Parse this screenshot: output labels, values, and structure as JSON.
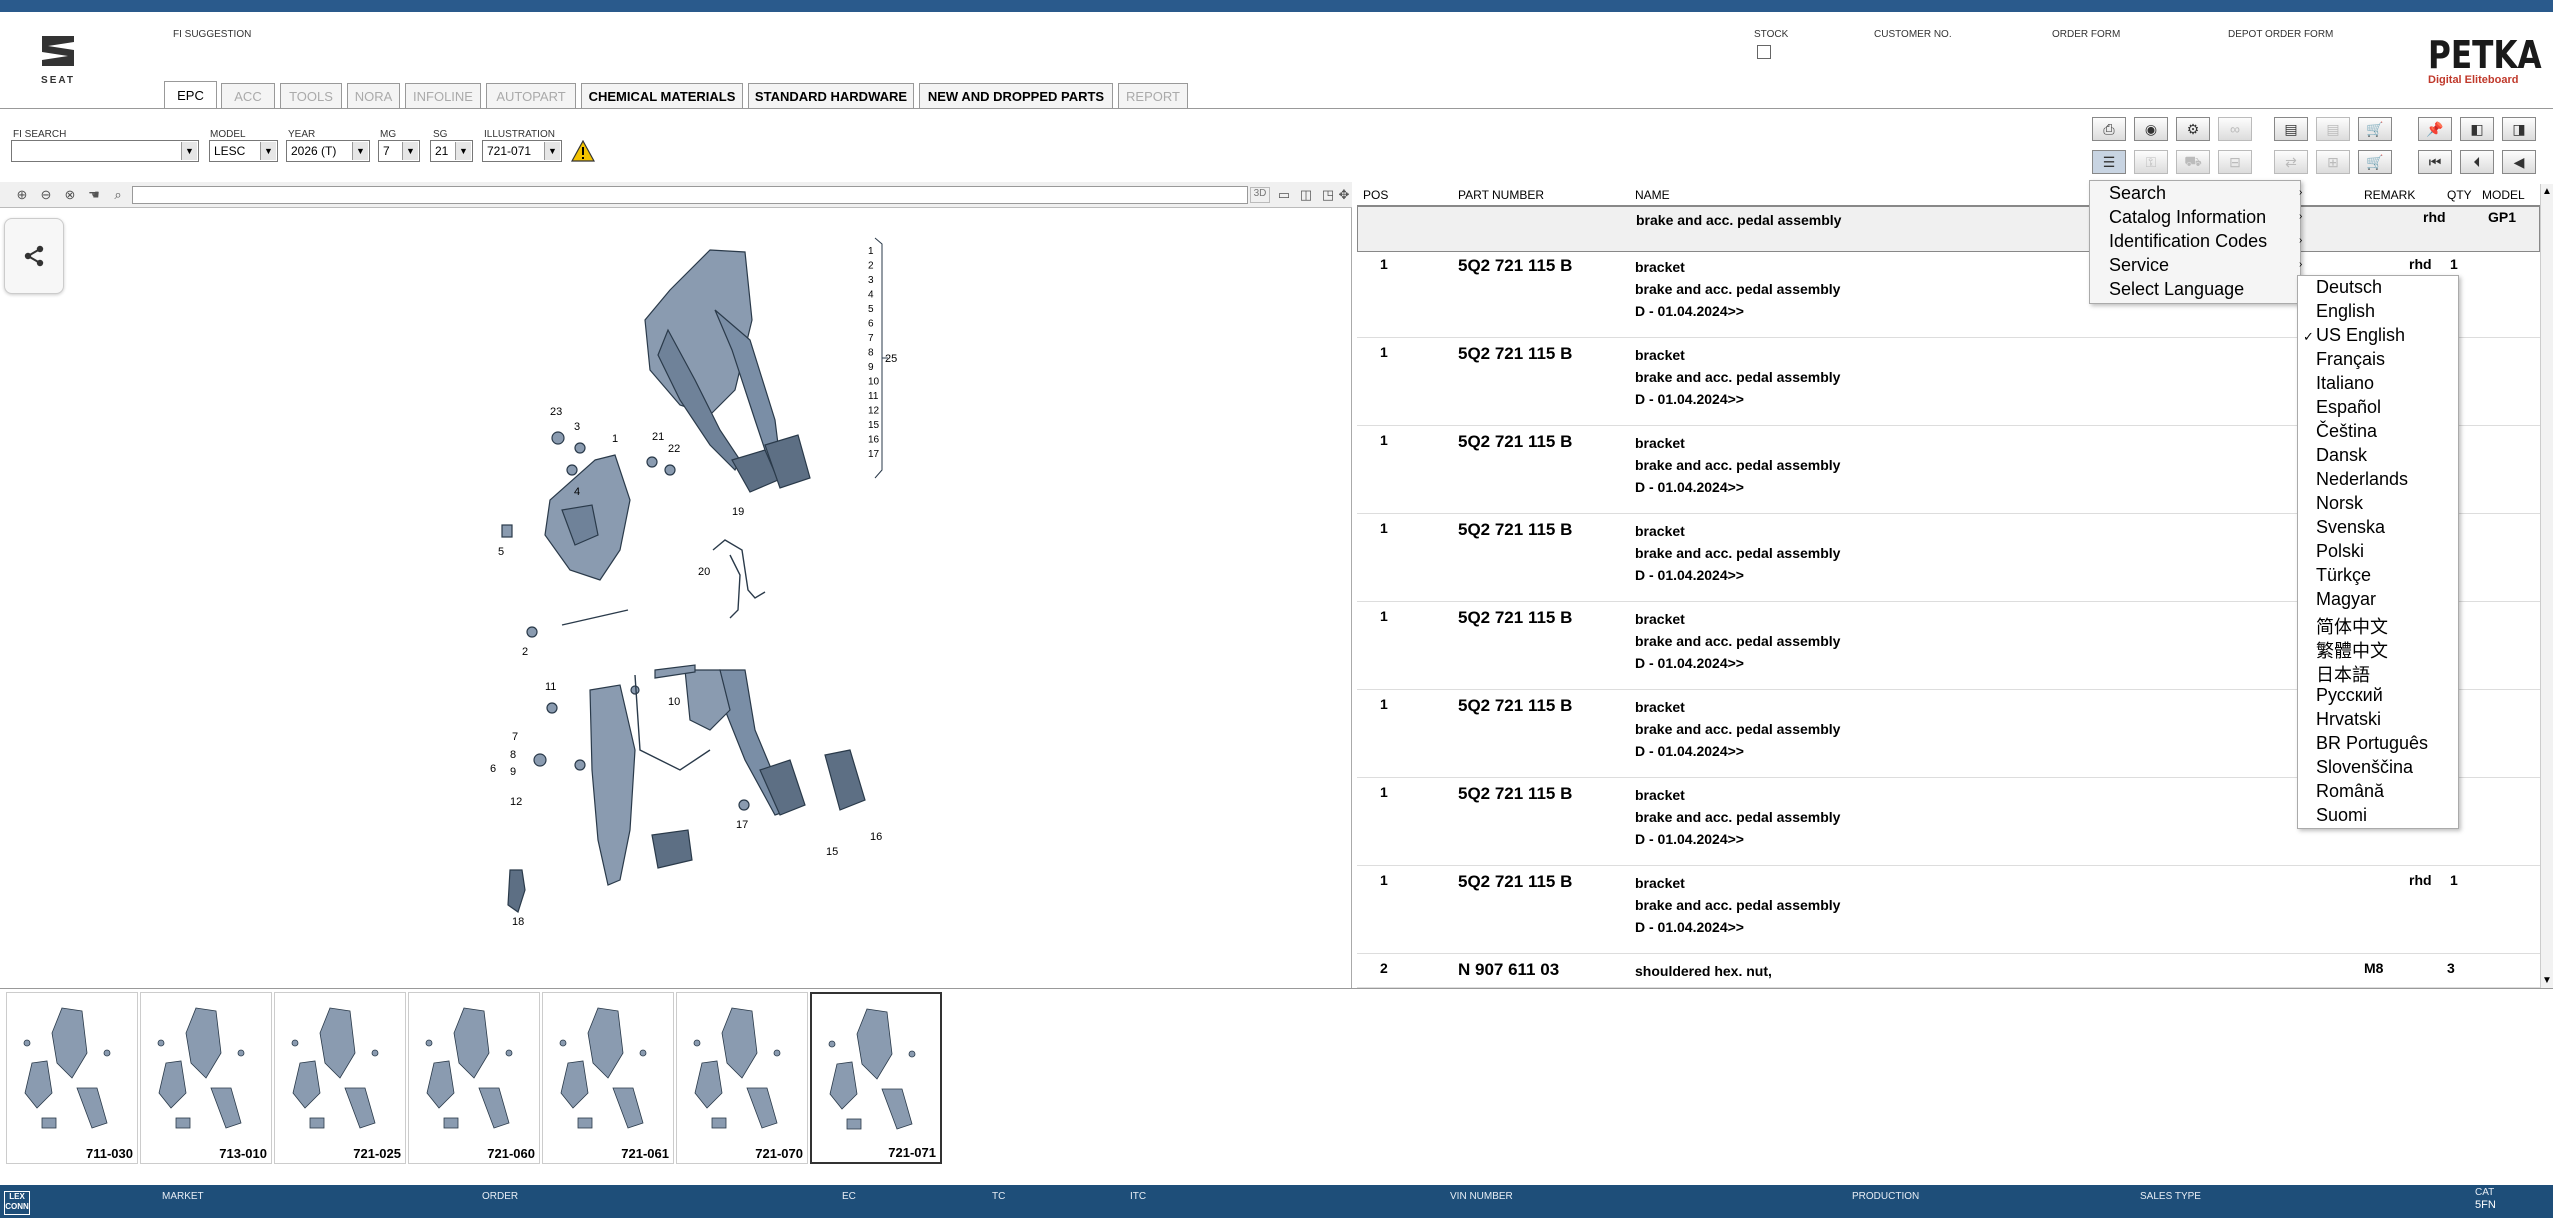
{
  "header": {
    "brand": "SEAT",
    "fi_suggestion_label": "FI SUGGESTION",
    "stock_label": "STOCK",
    "customer_no_label": "CUSTOMER NO.",
    "order_form_label": "ORDER FORM",
    "depot_order_form_label": "DEPOT ORDER FORM",
    "petka_title": "PETKA",
    "petka_subtitle": "Digital Eliteboard"
  },
  "tabs": [
    {
      "label": "EPC",
      "state": "active"
    },
    {
      "label": "ACC",
      "state": "disabled"
    },
    {
      "label": "TOOLS",
      "state": "disabled"
    },
    {
      "label": "NORA",
      "state": "disabled"
    },
    {
      "label": "INFOLINE",
      "state": "disabled"
    },
    {
      "label": "AUTOPART",
      "state": "disabled"
    },
    {
      "label": "CHEMICAL MATERIALS",
      "state": "enabled"
    },
    {
      "label": "STANDARD HARDWARE",
      "state": "enabled"
    },
    {
      "label": "NEW AND DROPPED PARTS",
      "state": "enabled"
    },
    {
      "label": "REPORT",
      "state": "disabled"
    }
  ],
  "selectors": {
    "fi_search": {
      "label": "FI SEARCH",
      "value": ""
    },
    "model": {
      "label": "MODEL",
      "value": "LESC"
    },
    "year": {
      "label": "YEAR",
      "value": "2026 (T)"
    },
    "mg": {
      "label": "MG",
      "value": "7"
    },
    "sg": {
      "label": "SG",
      "value": "21"
    },
    "illustration": {
      "label": "ILLUSTRATION",
      "value": "721-071"
    }
  },
  "illustration_toolbar": {
    "label_3d": "3D"
  },
  "diagram_callouts": [
    "1",
    "2",
    "3",
    "4",
    "5",
    "6",
    "7",
    "8",
    "9",
    "10",
    "11",
    "12",
    "15",
    "16",
    "17",
    "18",
    "19",
    "20",
    "21",
    "22",
    "23",
    "25"
  ],
  "bracket_callouts": [
    "1",
    "2",
    "3",
    "4",
    "5",
    "6",
    "7",
    "8",
    "9",
    "10",
    "11",
    "12",
    "15",
    "16",
    "17"
  ],
  "table": {
    "headers": {
      "pos": "POS",
      "part_number": "PART NUMBER",
      "name": "NAME",
      "remark": "REMARK",
      "qty": "QTY",
      "model": "MODEL"
    },
    "group_row": {
      "name": "brake and acc. pedal assembly",
      "remark": "rhd",
      "model": "GP1"
    },
    "rows": [
      {
        "pos": "1",
        "part_number": "5Q2 721 115 B",
        "name": "bracket",
        "name2": "brake and acc. pedal assembly",
        "name3": "D - 01.04.2024>>",
        "remark": "rhd",
        "qty": "1"
      },
      {
        "pos": "1",
        "part_number": "5Q2 721 115 B",
        "name": "bracket",
        "name2": "brake and acc. pedal assembly",
        "name3": "D - 01.04.2024>>",
        "remark": "",
        "qty": ""
      },
      {
        "pos": "1",
        "part_number": "5Q2 721 115 B",
        "name": "bracket",
        "name2": "brake and acc. pedal assembly",
        "name3": "D - 01.04.2024>>",
        "remark": "",
        "qty": ""
      },
      {
        "pos": "1",
        "part_number": "5Q2 721 115 B",
        "name": "bracket",
        "name2": "brake and acc. pedal assembly",
        "name3": "D - 01.04.2024>>",
        "remark": "",
        "qty": ""
      },
      {
        "pos": "1",
        "part_number": "5Q2 721 115 B",
        "name": "bracket",
        "name2": "brake and acc. pedal assembly",
        "name3": "D - 01.04.2024>>",
        "remark": "",
        "qty": ""
      },
      {
        "pos": "1",
        "part_number": "5Q2 721 115 B",
        "name": "bracket",
        "name2": "brake and acc. pedal assembly",
        "name3": "D - 01.04.2024>>",
        "remark": "",
        "qty": ""
      },
      {
        "pos": "1",
        "part_number": "5Q2 721 115 B",
        "name": "bracket",
        "name2": "brake and acc. pedal assembly",
        "name3": "D - 01.04.2024>>",
        "remark": "",
        "qty": ""
      },
      {
        "pos": "1",
        "part_number": "5Q2 721 115 B",
        "name": "bracket",
        "name2": "brake and acc. pedal assembly",
        "name3": "D - 01.04.2024>>",
        "remark": "rhd",
        "qty": "1"
      },
      {
        "pos": "2",
        "part_number": "N  907 611 03",
        "name": "shouldered hex. nut,",
        "name2": "",
        "name3": "",
        "remark": "M8",
        "qty": "3"
      }
    ]
  },
  "context_menu": {
    "items": [
      "Search",
      "Catalog Information",
      "Identification Codes",
      "Service",
      "Select Language"
    ]
  },
  "language_menu": {
    "selected": "US English",
    "items": [
      "Deutsch",
      "English",
      "US English",
      "Français",
      "Italiano",
      "Español",
      "Čeština",
      "Dansk",
      "Nederlands",
      "Norsk",
      "Svenska",
      "Polski",
      "Türkçe",
      "Magyar",
      "简体中文",
      "繁體中文",
      "日本語",
      "Русский",
      "Hrvatski",
      "BR Português",
      "Slovenščina",
      "Română",
      "Suomi"
    ]
  },
  "thumbnails": [
    "711-030",
    "713-010",
    "721-025",
    "721-060",
    "721-061",
    "721-070",
    "721-071"
  ],
  "selected_thumbnail": "721-071",
  "statusbar": {
    "logo_line1": "LEX",
    "logo_line2": "CONN",
    "market": "MARKET",
    "order": "ORDER",
    "ec": "EC",
    "tc": "TC",
    "itc": "ITC",
    "vin_number": "VIN NUMBER",
    "production": "PRODUCTION",
    "sales_type": "SALES TYPE",
    "cat_label": "CAT",
    "cat_value": "5FN"
  },
  "colors": {
    "topbar": "#2a5a8c",
    "statusbar": "#1e4e79",
    "warning": "#f2c200"
  },
  "icons": [
    "seat-logo-icon",
    "share-icon",
    "warning-icon",
    "zoom-in-icon",
    "zoom-out-icon",
    "print-icon",
    "cart-icon",
    "pin-icon",
    "first-page-icon",
    "prev-page-icon",
    "back-icon",
    "checkmark-icon",
    "submenu-arrow-icon"
  ]
}
